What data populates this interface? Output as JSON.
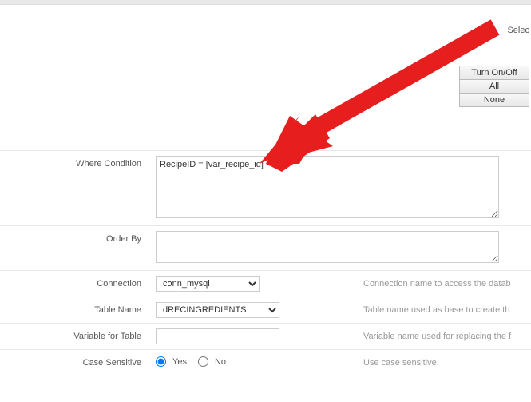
{
  "headers": {
    "col1": "",
    "col2": "",
    "col3": ""
  },
  "sel_label": "Selec",
  "buttons": {
    "toggle": "Turn On/Off",
    "all": "All",
    "none": "None"
  },
  "form": {
    "where_label": "Where Condition",
    "where_value": "RecipeID = [var_recipe_id]",
    "orderby_label": "Order By",
    "orderby_value": "",
    "connection_label": "Connection",
    "connection_value": "conn_mysql",
    "connection_hint": "Connection name to access the datab",
    "table_label": "Table Name",
    "table_value": "dRECINGREDIENTS",
    "table_hint": "Table name used as base to create th",
    "vartable_label": "Variable for Table",
    "vartable_value": "",
    "vartable_hint": "Variable name used for replacing the f",
    "case_label": "Case Sensitive",
    "case_yes": "Yes",
    "case_no": "No",
    "case_hint": "Use case sensitive."
  }
}
